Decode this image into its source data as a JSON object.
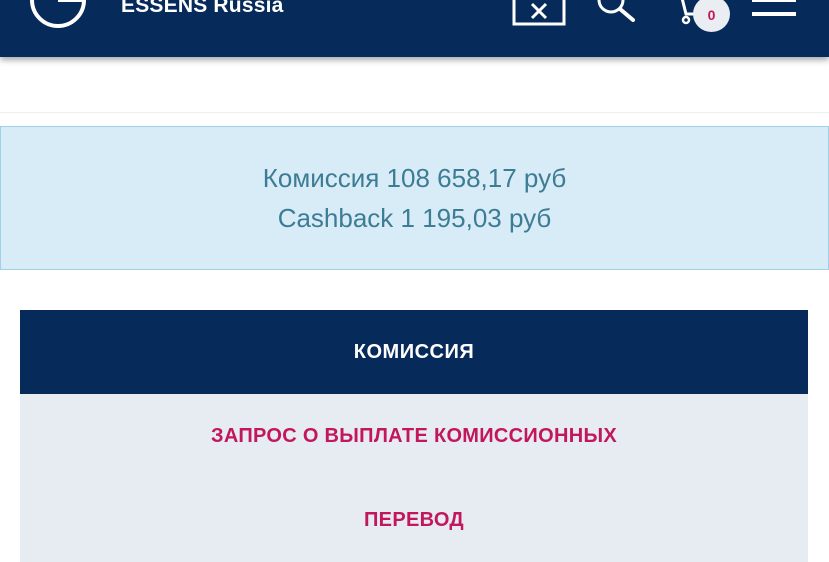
{
  "header": {
    "brand": "ESSENS Russia",
    "cart_count": "0",
    "icons": {
      "logo": "essens-logo",
      "close": "close-icon",
      "search": "search-icon",
      "cart": "cart-icon",
      "menu": "hamburger-menu-icon"
    },
    "colors": {
      "background": "#062b5b",
      "badge_text": "#c2185b"
    }
  },
  "summary": {
    "commission_line": "Комиссия 108 658,17 руб",
    "cashback_line": "Cashback 1 195,03 руб",
    "colors": {
      "background": "#d8ecf7",
      "text": "#3d7c95"
    }
  },
  "commission_menu": {
    "title": "КОМИССИЯ",
    "items": [
      {
        "label": "ЗАПРОС О ВЫПЛАТЕ КОМИССИОННЫХ"
      },
      {
        "label": "ПЕРЕВОД"
      }
    ],
    "colors": {
      "header": "#062b5b",
      "panel": "#e6ecf1",
      "link": "#c2185b"
    }
  }
}
